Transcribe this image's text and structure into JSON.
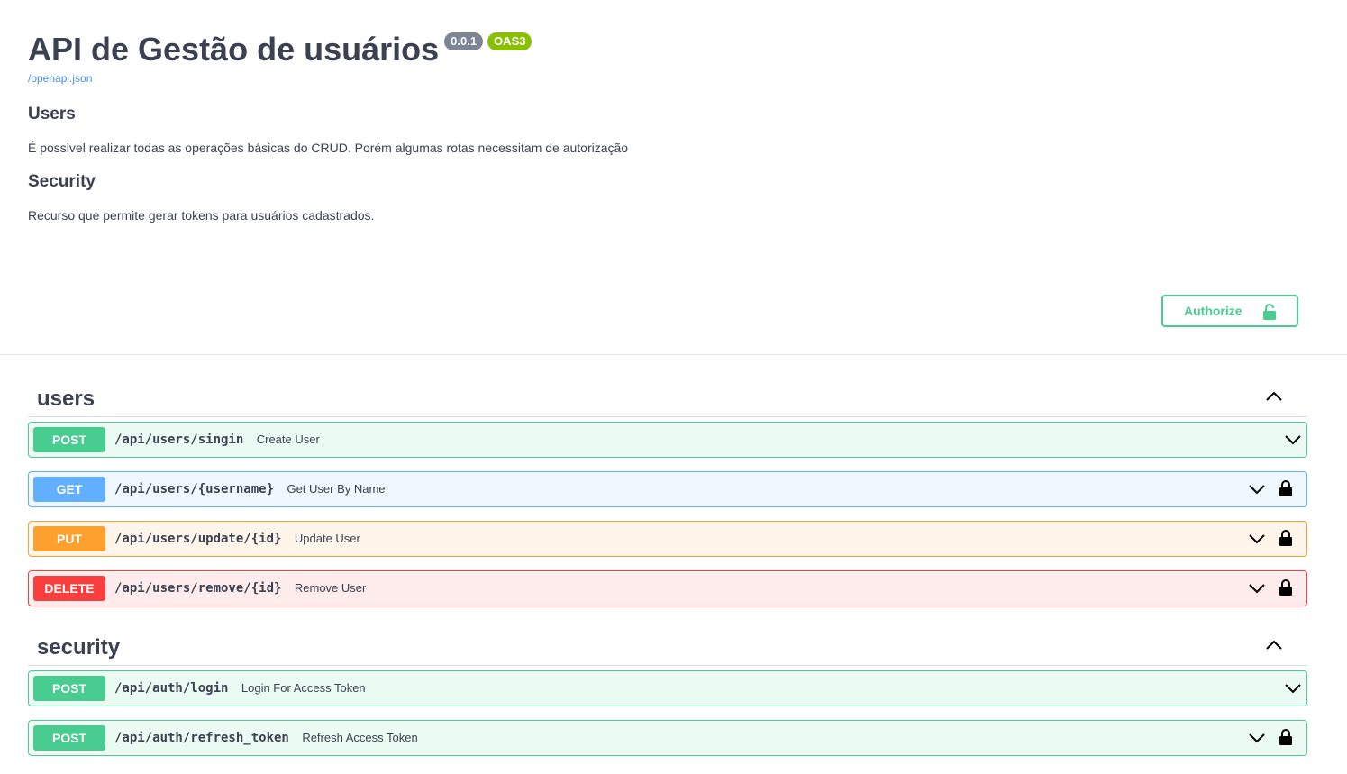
{
  "info": {
    "title": "API de Gestão de usuários",
    "version": "0.0.1",
    "oas_badge": "OAS3",
    "spec_link": "/openapi.json",
    "sections": [
      {
        "heading": "Users",
        "text": "É possivel realizar todas as operações básicas do CRUD. Porém algumas rotas necessitam de autorização"
      },
      {
        "heading": "Security",
        "text": "Recurso que permite gerar tokens para usuários cadastrados."
      }
    ]
  },
  "authorize": {
    "label": "Authorize",
    "icon": "lock-icon"
  },
  "colors": {
    "post": "#49cc90",
    "get": "#61affe",
    "put": "#fca130",
    "delete": "#f93e3e"
  },
  "tags": [
    {
      "name": "users",
      "operations": [
        {
          "method": "POST",
          "path": "/api/users/singin",
          "summary": "Create User",
          "locked": false
        },
        {
          "method": "GET",
          "path": "/api/users/{username}",
          "summary": "Get User By Name",
          "locked": true
        },
        {
          "method": "PUT",
          "path": "/api/users/update/{id}",
          "summary": "Update User",
          "locked": true
        },
        {
          "method": "DELETE",
          "path": "/api/users/remove/{id}",
          "summary": "Remove User",
          "locked": true
        }
      ]
    },
    {
      "name": "security",
      "operations": [
        {
          "method": "POST",
          "path": "/api/auth/login",
          "summary": "Login For Access Token",
          "locked": false
        },
        {
          "method": "POST",
          "path": "/api/auth/refresh_token",
          "summary": "Refresh Access Token",
          "locked": true
        }
      ]
    }
  ]
}
